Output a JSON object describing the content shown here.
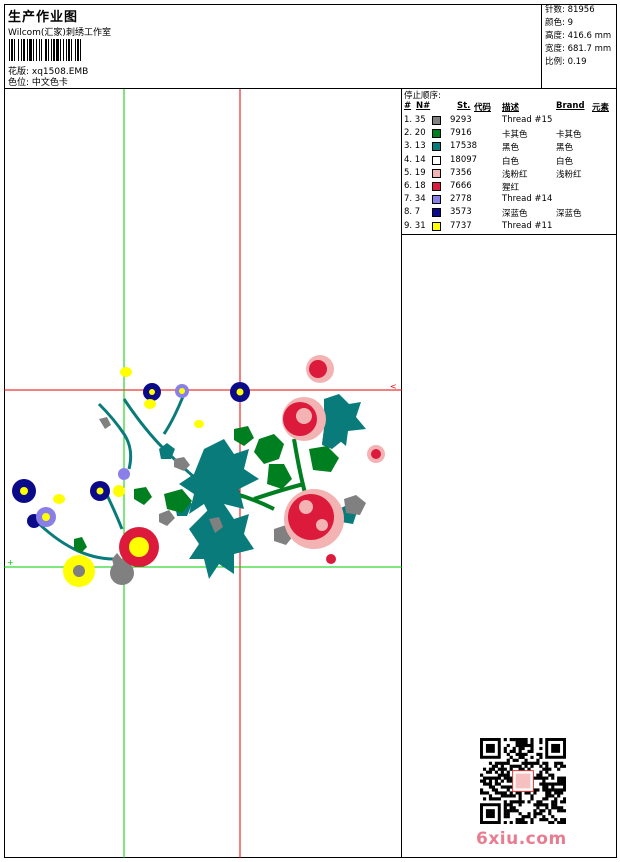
{
  "header": {
    "title": "生产作业图",
    "studio": "Wilcom(汇家)刺绣工作室",
    "fabric_label": "花版: xq1508.EMB",
    "color_card": "色位: 中文色卡"
  },
  "stats": {
    "stitches": "针数: 81956",
    "colors": "颜色: 9",
    "height": "高度: 416.6 mm",
    "width": "宽度: 681.7 mm",
    "scale": "比例: 0.19"
  },
  "legend": {
    "title": "停止顺序:",
    "headers": {
      "num": "#",
      "n": "N#",
      "st": "St.",
      "code": "代码",
      "desc": "描述",
      "brand": "Brand",
      "elem": "元素"
    },
    "rows": [
      {
        "idx": "1. 35",
        "color": "#808080",
        "code": "9293",
        "desc": "Thread #15",
        "brand": ""
      },
      {
        "idx": "2. 20",
        "color": "#007f20",
        "code": "7916",
        "desc": "卡其色",
        "brand": "卡其色"
      },
      {
        "idx": "3. 13",
        "color": "#0a7b7b",
        "code": "17538",
        "desc": "黑色",
        "brand": "黑色"
      },
      {
        "idx": "4. 14",
        "color": "#ffffff",
        "code": "18097",
        "desc": "白色",
        "brand": "白色"
      },
      {
        "idx": "5. 19",
        "color": "#f4b3b3",
        "code": "7356",
        "desc": "浅粉红",
        "brand": "浅粉红"
      },
      {
        "idx": "6. 18",
        "color": "#dc1a3c",
        "code": "7666",
        "desc": "猩红",
        "brand": ""
      },
      {
        "idx": "7. 34",
        "color": "#8a7fe8",
        "code": "2778",
        "desc": "Thread #14",
        "brand": ""
      },
      {
        "idx": "8. 7",
        "color": "#0b0b8a",
        "code": "3573",
        "desc": "深蓝色",
        "brand": "深蓝色"
      },
      {
        "idx": "9. 31",
        "color": "#ffff00",
        "code": "7737",
        "desc": "Thread #11",
        "brand": ""
      }
    ]
  },
  "watermark": {
    "site": "6xiu.com"
  }
}
